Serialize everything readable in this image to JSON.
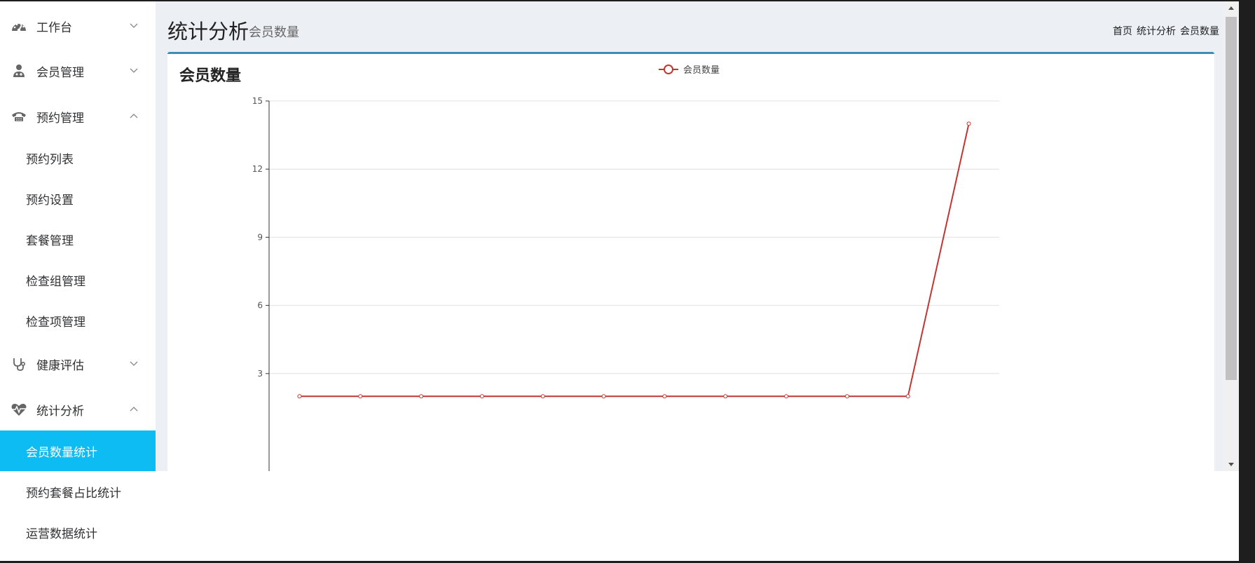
{
  "sidebar": {
    "groups": [
      {
        "label": "工作台",
        "icon": "dashboard-icon",
        "expanded": false
      },
      {
        "label": "会员管理",
        "icon": "user-doctor-icon",
        "expanded": false
      },
      {
        "label": "预约管理",
        "icon": "phone-icon",
        "expanded": true
      },
      {
        "label": "健康评估",
        "icon": "stethoscope-icon",
        "expanded": false
      },
      {
        "label": "统计分析",
        "icon": "heartbeat-icon",
        "expanded": true
      }
    ],
    "reservation_items": [
      "预约列表",
      "预约设置",
      "套餐管理",
      "检查组管理",
      "检查项管理"
    ],
    "stats_items": [
      "会员数量统计",
      "预约套餐占比统计",
      "运营数据统计"
    ],
    "active_item": "会员数量统计"
  },
  "header": {
    "title": "统计分析",
    "subtitle": "会员数量",
    "breadcrumb": [
      "首页",
      "统计分析",
      "会员数量"
    ]
  },
  "card": {
    "title": "会员数量"
  },
  "colors": {
    "accent": "#0cbcf3",
    "card_border": "#3c8dbc",
    "series": "#c23531",
    "main_bg": "#ecf0f5"
  },
  "chart_data": {
    "type": "line",
    "title": "会员数量",
    "xlabel": "",
    "ylabel": "",
    "ylim": [
      0,
      15
    ],
    "yticks": [
      3,
      6,
      9,
      12,
      15
    ],
    "grid": true,
    "legend_placement": "top-center",
    "series": [
      {
        "name": "会员数量",
        "values": [
          2,
          2,
          2,
          2,
          2,
          2,
          2,
          2,
          2,
          2,
          2,
          14
        ]
      }
    ]
  }
}
